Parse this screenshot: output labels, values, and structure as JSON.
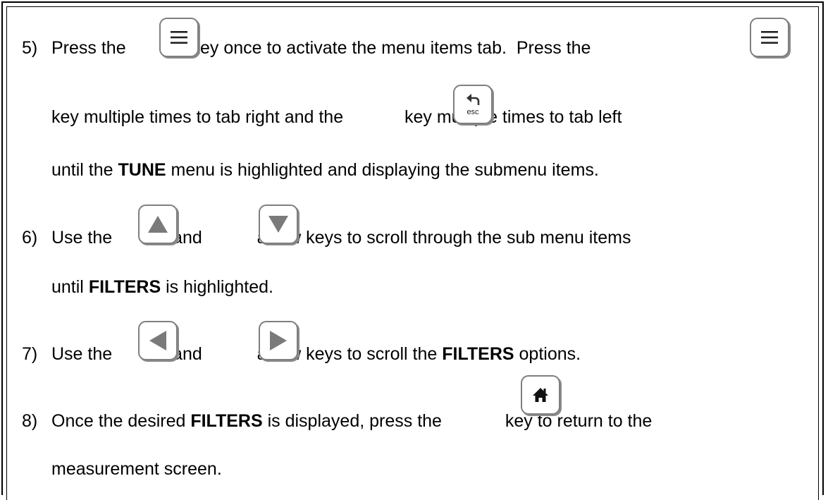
{
  "steps": [
    {
      "number": "5)",
      "line1": {
        "a": "Press the ",
        "b": " key once to activate the menu items tab.  Press the "
      },
      "line2": {
        "a": "key multiple times to tab right and the ",
        "b": " key multiple times to tab left"
      },
      "line3": {
        "a": "until the ",
        "bold": "TUNE",
        "b": " menu is highlighted and displaying the submenu items."
      }
    },
    {
      "number": "6)",
      "line1": {
        "a": "Use the ",
        "mid": " and ",
        "b": " arrow keys to scroll through the sub menu items"
      },
      "line2": {
        "a": "until ",
        "bold": "FILTERS",
        "b": " is highlighted."
      }
    },
    {
      "number": "7)",
      "line1": {
        "a": "Use the ",
        "mid": " and ",
        "b": " arrow keys to scroll the ",
        "bold": "FILTERS",
        "c": " options."
      }
    },
    {
      "number": "8)",
      "line1": {
        "a": "Once the desired ",
        "bold": "FILTERS",
        "b": " is displayed, press the ",
        "c": " key to return to the"
      },
      "line2": {
        "a": "measurement screen."
      }
    }
  ],
  "keys": {
    "menu": "menu-icon",
    "esc": "back-arrow-icon",
    "esc_label": "esc",
    "up": "up-arrow-icon",
    "down": "down-arrow-icon",
    "left": "left-arrow-icon",
    "right": "right-arrow-icon",
    "home": "home-icon",
    "border_color": "#7f7f7f",
    "arrow_color": "#7a7a7a"
  }
}
